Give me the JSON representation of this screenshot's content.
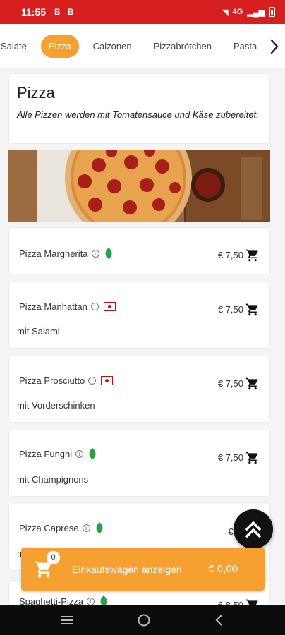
{
  "status_bar": {
    "time": "11:55",
    "network": "4G",
    "colors": {
      "background": "#d71f1f"
    }
  },
  "tabs": [
    {
      "label": "Salate",
      "active": false
    },
    {
      "label": "Pizza",
      "active": true
    },
    {
      "label": "Calzonen",
      "active": false
    },
    {
      "label": "Pizzabrötchen",
      "active": false
    },
    {
      "label": "Pasta",
      "active": false
    }
  ],
  "section": {
    "title": "Pizza",
    "subtitle": "Alle Pizzen werden mit Tomatensauce und Käse zubereitet."
  },
  "items": [
    {
      "name": "Pizza Margherita",
      "badge": "leaf-icon",
      "description": "",
      "price": "€ 7,50"
    },
    {
      "name": "Pizza Manhattan",
      "badge": "meat-icon",
      "description": "mit Salami",
      "price": "€ 7,50"
    },
    {
      "name": "Pizza Prosciutto",
      "badge": "meat-icon",
      "description": "mit Vorderschinken",
      "price": "€ 7,50"
    },
    {
      "name": "Pizza Funghi",
      "badge": "leaf-icon",
      "description": "mit Champignons",
      "price": "€ 7,50"
    },
    {
      "name": "Pizza Caprese",
      "badge": "leaf-icon",
      "description": "m",
      "price": "€ 7,"
    },
    {
      "name": "Spaghetti-Pizza",
      "badge": "leaf-icon",
      "description": "",
      "price": "€ 8,50"
    }
  ],
  "cart_bar": {
    "count": "0",
    "label": "Einkaufswagen anzeigen",
    "total": "€ 0,00"
  },
  "colors": {
    "accent": "#f5a030",
    "veg": "#2e9e4a",
    "meat": "#c11111"
  }
}
